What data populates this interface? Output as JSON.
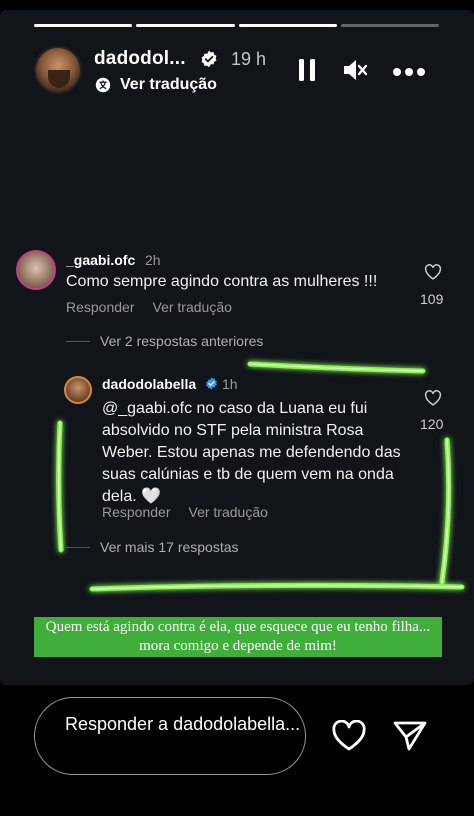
{
  "header": {
    "username": "dadodol...",
    "time": "19 h",
    "translate_label": "Ver tradução",
    "progress_segments": 4,
    "progress_done": 3
  },
  "comment": {
    "username": "_gaabi.ofc",
    "time": "2h",
    "text": "Como sempre agindo contra as mulheres !!!",
    "reply_label": "Responder",
    "translate_label": "Ver tradução",
    "likes": "109"
  },
  "view_previous": "Ver 2 respostas anteriores",
  "reply_comment": {
    "username": "dadodolabella",
    "time": "1h",
    "text": "@_gaabi.ofc no caso da Luana eu fui absolvido no STF pela ministra Rosa Weber. Estou apenas me defendendo das suas calúnias e tb de quem vem na onda dela. 🤍",
    "reply_label": "Responder",
    "translate_label": "Ver tradução",
    "likes": "120"
  },
  "view_more": "Ver mais 17 respostas",
  "caption": "Quem está agindo contra é ela, que esquece que eu tenho filha... mora comigo e depende de mim!",
  "reply_bar": {
    "placeholder": "Responder a dadodolabella..."
  },
  "colors": {
    "neon": "#7dff3a",
    "caption_bg": "#3fae3a",
    "verified": "#3897f0"
  }
}
